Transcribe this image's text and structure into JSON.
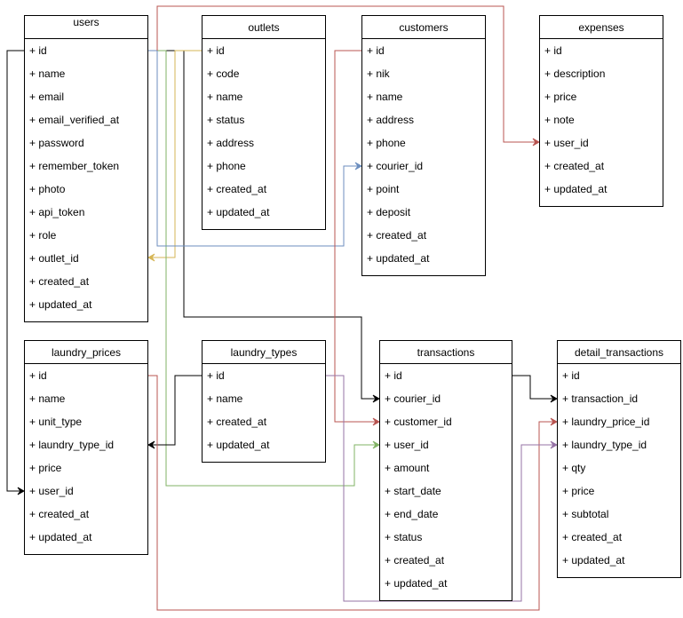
{
  "tables": [
    {
      "id": "users",
      "title": "users",
      "fields": [
        "id",
        "name",
        "email",
        "email_verified_at",
        "password",
        "remember_token",
        "photo",
        "api_token",
        "role",
        "outlet_id",
        "created_at",
        "updated_at"
      ]
    },
    {
      "id": "outlets",
      "title": "outlets",
      "fields": [
        "id",
        "code",
        "name",
        "status",
        "address",
        "phone",
        "created_at",
        "updated_at"
      ]
    },
    {
      "id": "customers",
      "title": "customers",
      "fields": [
        "id",
        "nik",
        "name",
        "address",
        "phone",
        "courier_id",
        "point",
        "deposit",
        "created_at",
        "updated_at"
      ]
    },
    {
      "id": "expenses",
      "title": "expenses",
      "fields": [
        "id",
        "description",
        "price",
        "note",
        "user_id",
        "created_at",
        "updated_at"
      ]
    },
    {
      "id": "laundry_prices",
      "title": "laundry_prices",
      "fields": [
        "id",
        "name",
        "unit_type",
        "laundry_type_id",
        "price",
        "user_id",
        "created_at",
        "updated_at"
      ]
    },
    {
      "id": "laundry_types",
      "title": "laundry_types",
      "fields": [
        "id",
        "name",
        "created_at",
        "updated_at"
      ]
    },
    {
      "id": "transactions",
      "title": "transactions",
      "fields": [
        "id",
        "courier_id",
        "customer_id",
        "user_id",
        "amount",
        "start_date",
        "end_date",
        "status",
        "created_at",
        "updated_at"
      ]
    },
    {
      "id": "detail_transactions",
      "title": "detail_transactions",
      "fields": [
        "id",
        "transaction_id",
        "laundry_price_id",
        "laundry_type_id",
        "qty",
        "price",
        "subtotal",
        "created_at",
        "updated_at"
      ]
    }
  ],
  "field_prefix": "+ ",
  "relations": [
    {
      "from": "users.id",
      "to": "laundry_prices.user_id",
      "color": "#000000"
    },
    {
      "from": "users.id",
      "to": "transactions.courier_id",
      "color": "#000000"
    },
    {
      "from": "outlets.id",
      "to": "users.outlet_id",
      "color": "#d6b656"
    },
    {
      "from": "users.id",
      "to": "transactions.user_id",
      "color": "#82b366"
    },
    {
      "from": "users.id",
      "to": "customers.courier_id",
      "color": "#6c8ebf"
    },
    {
      "from": "users.id",
      "to": "expenses.user_id",
      "color": "#b85450"
    },
    {
      "from": "customers.id",
      "to": "transactions.customer_id",
      "color": "#b85450"
    },
    {
      "from": "laundry_types.id",
      "to": "laundry_prices.laundry_type_id",
      "color": "#000000"
    },
    {
      "from": "laundry_prices.id",
      "to": "detail_transactions.laundry_price_id",
      "color": "#b85450"
    },
    {
      "from": "laundry_types.id",
      "to": "detail_transactions.laundry_type_id",
      "color": "#9673a6"
    },
    {
      "from": "transactions.id",
      "to": "detail_transactions.transaction_id",
      "color": "#000000"
    }
  ]
}
